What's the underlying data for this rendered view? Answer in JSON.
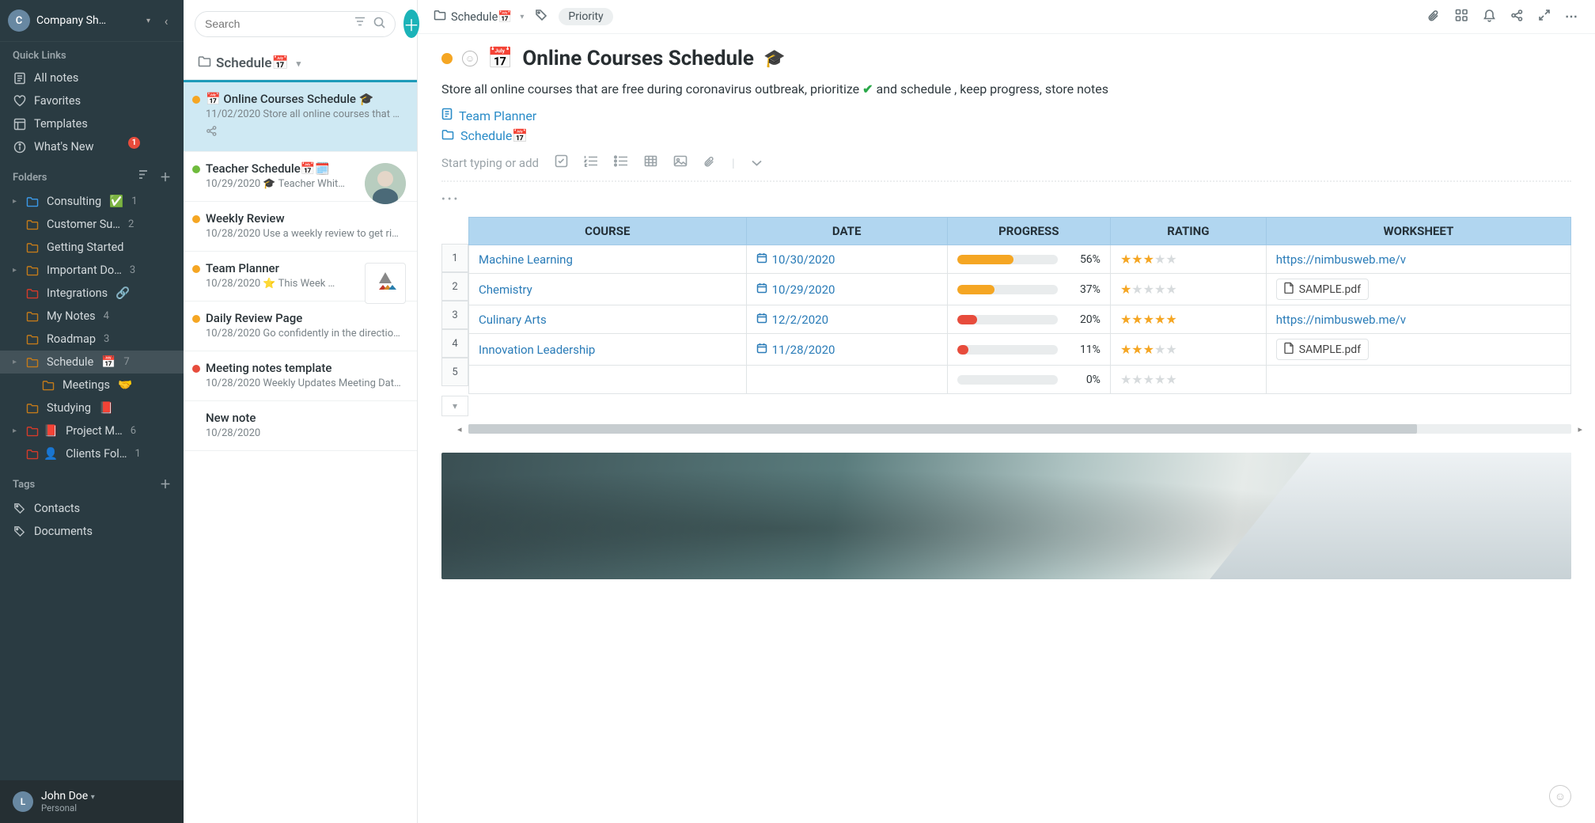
{
  "workspace": {
    "initial": "C",
    "name": "Company Sh…"
  },
  "sidebar": {
    "quick_links_title": "Quick Links",
    "quick_links": [
      {
        "icon": "note",
        "label": "All notes"
      },
      {
        "icon": "heart",
        "label": "Favorites"
      },
      {
        "icon": "template",
        "label": "Templates"
      },
      {
        "icon": "info",
        "label": "What's New",
        "badge": "1"
      }
    ],
    "folders_title": "Folders",
    "folders": [
      {
        "caret": true,
        "icon": "folder",
        "label": "Consulting",
        "suffix_emoji": "✅",
        "count": "1",
        "color": "#3b99e8"
      },
      {
        "icon": "folder",
        "label": "Customer Su…",
        "count": "2",
        "color": "#c27a1a"
      },
      {
        "icon": "folder",
        "label": "Getting Started",
        "color": "#c27a1a"
      },
      {
        "caret": true,
        "icon": "folder",
        "label": "Important Do…",
        "count": "3",
        "color": "#c27a1a"
      },
      {
        "icon": "folder",
        "label": "Integrations",
        "suffix_emoji": "🔗",
        "color": "#d43b2a"
      },
      {
        "icon": "folder",
        "label": "My Notes",
        "count": "4",
        "color": "#c27a1a"
      },
      {
        "icon": "folder",
        "label": "Roadmap",
        "count": "3",
        "color": "#c27a1a"
      },
      {
        "caret": true,
        "selected": true,
        "icon": "folder",
        "label": "Schedule",
        "suffix_emoji": "📅",
        "count": "7",
        "color": "#c27a1a"
      },
      {
        "indent": true,
        "icon": "folder",
        "label": "Meetings",
        "suffix_emoji": "🤝",
        "color": "#c27a1a"
      },
      {
        "icon": "folder",
        "label": "Studying",
        "suffix_emoji": "📕",
        "color": "#c27a1a"
      },
      {
        "caret": true,
        "icon": "red-square",
        "label": "Project M…",
        "count": "6",
        "color": "#d43b2a",
        "emoji_prefix": "📕"
      },
      {
        "icon": "folder",
        "label": "Clients Fol…",
        "count": "1",
        "color": "#d43b2a",
        "emoji_prefix": "👤"
      }
    ],
    "tags_title": "Tags",
    "tags": [
      {
        "icon": "tag",
        "label": "Contacts"
      },
      {
        "icon": "tag",
        "label": "Documents"
      }
    ]
  },
  "user": {
    "initial": "L",
    "name": "John Doe",
    "workspace": "Personal"
  },
  "notelist": {
    "search_placeholder": "Search",
    "breadcrumb_label": "Schedule",
    "breadcrumb_emoji": "📅",
    "items": [
      {
        "dot": "#f5a623",
        "title": "📅 Online Courses Schedule 🎓",
        "date": "11/02/2020",
        "preview": "Store all online courses that ar…",
        "active": true,
        "shared": true
      },
      {
        "dot": "#6fbb3c",
        "title": "Teacher Schedule📅🗓️",
        "date": "10/29/2020",
        "preview": "🎓 Teacher Whit…",
        "thumb": true
      },
      {
        "dot": "#f5a623",
        "title": "Weekly Review",
        "date": "10/28/2020",
        "preview": "Use a weekly review to get rid …"
      },
      {
        "dot": "#f5a623",
        "title": "Team Planner",
        "date": "10/28/2020",
        "preview": "⭐ This Week …",
        "thumb_alt": true
      },
      {
        "dot": "#f5a623",
        "title": "Daily Review Page",
        "date": "10/28/2020",
        "preview": "Go confidently in the direction …"
      },
      {
        "dot": "#e74c3c",
        "title": "Meeting notes template",
        "date": "10/28/2020",
        "preview": "Weekly Updates Meeting Date:…"
      },
      {
        "title": "New note",
        "date": "10/28/2020",
        "preview": ""
      }
    ]
  },
  "editor": {
    "toolbar": {
      "breadcrumb_label": "Schedule",
      "breadcrumb_emoji": "📅",
      "tag_label": "Priority"
    },
    "title": "Online Courses Schedule",
    "title_prefix_emoji": "📅",
    "title_suffix_emoji": "🎓",
    "desc_before": "Store all online courses that are free during coronavirus outbreak, prioritize ",
    "desc_after": " and schedule , keep progress, store notes",
    "link1_label": "Team Planner",
    "link2_label": "Schedule",
    "link2_emoji": "📅",
    "insert_placeholder": "Start typing or add"
  },
  "table": {
    "headers": [
      "COURSE",
      "DATE",
      "PROGRESS",
      "RATING",
      "WORKSHEET"
    ],
    "rows": [
      {
        "course": "Machine Learning",
        "date": "10/30/2020",
        "progress": 56,
        "fill": "#f5a623",
        "rating": 3,
        "ws_link": "https://nimbusweb.me/v"
      },
      {
        "course": "Chemistry",
        "date": "10/29/2020",
        "progress": 37,
        "fill": "#f5a623",
        "rating": 1,
        "ws_file": "SAMPLE.pdf"
      },
      {
        "course": "Culinary Arts",
        "date": "12/2/2020",
        "progress": 20,
        "fill": "#e74c3c",
        "rating": 5,
        "ws_link": "https://nimbusweb.me/v"
      },
      {
        "course": "Innovation Leadership",
        "date": "11/28/2020",
        "progress": 11,
        "fill": "#e74c3c",
        "rating": 3,
        "ws_file": "SAMPLE.pdf"
      },
      {
        "course": "",
        "date": "",
        "progress": 0,
        "fill": "#e9eced",
        "rating": 0
      }
    ]
  }
}
